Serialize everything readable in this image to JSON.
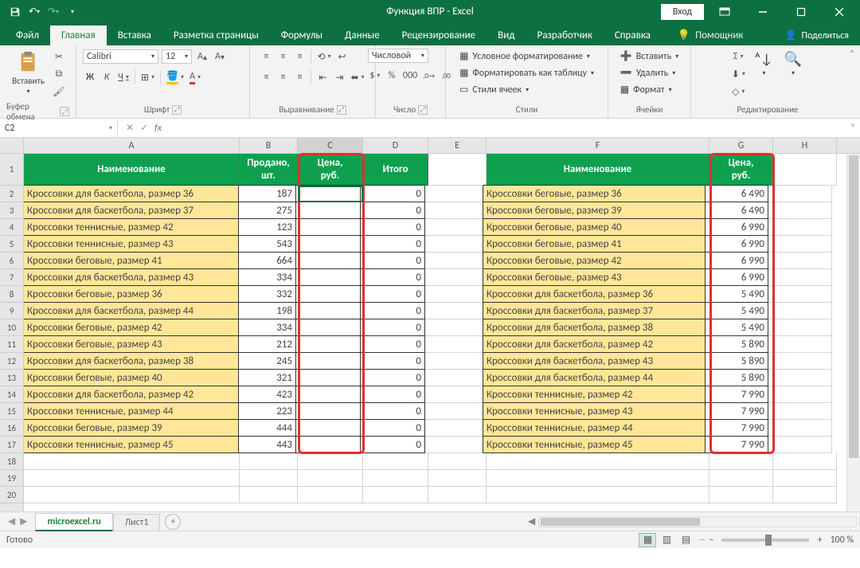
{
  "titlebar": {
    "title": "Функция ВПР - Excel",
    "signin": "Вход"
  },
  "tabs": {
    "file": "Файл",
    "home": "Главная",
    "insert": "Вставка",
    "layout": "Разметка страницы",
    "formulas": "Формулы",
    "data": "Данные",
    "review": "Рецензирование",
    "view": "Вид",
    "developer": "Разработчик",
    "help": "Справка",
    "tellme": "Помощник",
    "share": "Поделиться"
  },
  "ribbon": {
    "clipboard": {
      "paste": "Вставить",
      "label": "Буфер обмена"
    },
    "font": {
      "name": "Calibri",
      "size": "12",
      "label": "Шрифт"
    },
    "align": {
      "label": "Выравнивание"
    },
    "number": {
      "format": "Числовой",
      "label": "Число"
    },
    "styles": {
      "cond": "Условное форматирование",
      "table": "Форматировать как таблицу",
      "cell": "Стили ячеек",
      "label": "Стили"
    },
    "cells": {
      "insert": "Вставить",
      "delete": "Удалить",
      "format": "Формат",
      "label": "Ячейки"
    },
    "editing": {
      "label": "Редактирование"
    }
  },
  "namebox": "C2",
  "sheet": {
    "cols": [
      "A",
      "B",
      "C",
      "D",
      "E",
      "F",
      "G",
      "H"
    ],
    "header1": {
      "A": "Наименование",
      "B": "Продано, шт.",
      "C": "Цена, руб.",
      "D": "Итого",
      "F": "Наименование",
      "G": "Цена, руб."
    },
    "rows": [
      {
        "n": 2,
        "A": "Кроссовки для баскетбола, размер 36",
        "B": "187",
        "D": "0",
        "F": "Кроссовки беговые, размер 36",
        "G": "6 490"
      },
      {
        "n": 3,
        "A": "Кроссовки для баскетбола, размер 37",
        "B": "275",
        "D": "0",
        "F": "Кроссовки беговые, размер 39",
        "G": "6 490"
      },
      {
        "n": 4,
        "A": "Кроссовки теннисные, размер 42",
        "B": "123",
        "D": "0",
        "F": "Кроссовки беговые, размер 40",
        "G": "6 990"
      },
      {
        "n": 5,
        "A": "Кроссовки теннисные, размер 43",
        "B": "543",
        "D": "0",
        "F": "Кроссовки беговые, размер 41",
        "G": "6 990"
      },
      {
        "n": 6,
        "A": "Кроссовки беговые, размер 41",
        "B": "664",
        "D": "0",
        "F": "Кроссовки беговые, размер 42",
        "G": "6 990"
      },
      {
        "n": 7,
        "A": "Кроссовки для баскетбола, размер 43",
        "B": "334",
        "D": "0",
        "F": "Кроссовки беговые, размер 43",
        "G": "6 990"
      },
      {
        "n": 8,
        "A": "Кроссовки беговые, размер 36",
        "B": "332",
        "D": "0",
        "F": "Кроссовки для баскетбола, размер 36",
        "G": "5 490"
      },
      {
        "n": 9,
        "A": "Кроссовки для баскетбола, размер 44",
        "B": "198",
        "D": "0",
        "F": "Кроссовки для баскетбола, размер 37",
        "G": "5 490"
      },
      {
        "n": 10,
        "A": "Кроссовки беговые, размер 42",
        "B": "334",
        "D": "0",
        "F": "Кроссовки для баскетбола, размер 38",
        "G": "5 490"
      },
      {
        "n": 11,
        "A": "Кроссовки беговые, размер 43",
        "B": "212",
        "D": "0",
        "F": "Кроссовки для баскетбола, размер 42",
        "G": "5 890"
      },
      {
        "n": 12,
        "A": "Кроссовки для баскетбола, размер 38",
        "B": "245",
        "D": "0",
        "F": "Кроссовки для баскетбола, размер 43",
        "G": "5 890"
      },
      {
        "n": 13,
        "A": "Кроссовки беговые, размер 40",
        "B": "321",
        "D": "0",
        "F": "Кроссовки для баскетбола, размер 44",
        "G": "5 890"
      },
      {
        "n": 14,
        "A": "Кроссовки для баскетбола, размер 42",
        "B": "423",
        "D": "0",
        "F": "Кроссовки теннисные, размер 42",
        "G": "7 990"
      },
      {
        "n": 15,
        "A": "Кроссовки теннисные, размер 44",
        "B": "223",
        "D": "0",
        "F": "Кроссовки теннисные, размер 43",
        "G": "7 990"
      },
      {
        "n": 16,
        "A": "Кроссовки беговые, размер 39",
        "B": "444",
        "D": "0",
        "F": "Кроссовки теннисные, размер 44",
        "G": "7 990"
      },
      {
        "n": 17,
        "A": "Кроссовки теннисные, размер 45",
        "B": "443",
        "D": "0",
        "F": "Кроссовки теннисные, размер 45",
        "G": "7 990"
      }
    ]
  },
  "sheets": {
    "s1": "microexcel.ru",
    "s2": "Лист1"
  },
  "status": {
    "ready": "Готово",
    "zoom": "100 %"
  }
}
